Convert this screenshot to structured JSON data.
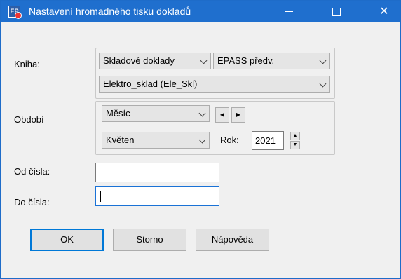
{
  "window": {
    "title": "Nastavení hromadného tisku dokladů",
    "app_icon_text": "EP",
    "controls": [
      "minimize",
      "maximize",
      "close"
    ]
  },
  "kniha": {
    "label": "Kniha:",
    "doc_type": "Skladové doklady",
    "epass": "EPASS předv.",
    "sklad": "Elektro_sklad (Ele_Skl)"
  },
  "obdobi": {
    "label": "Období",
    "period_type": "Měsíc",
    "month": "Květen",
    "rok_label": "Rok:",
    "year": "2021"
  },
  "od_cisla": {
    "label": "Od čísla:",
    "value": ""
  },
  "do_cisla": {
    "label": "Do čísla:",
    "value": ""
  },
  "buttons": {
    "ok": "OK",
    "storno": "Storno",
    "napoveda": "Nápověda"
  }
}
